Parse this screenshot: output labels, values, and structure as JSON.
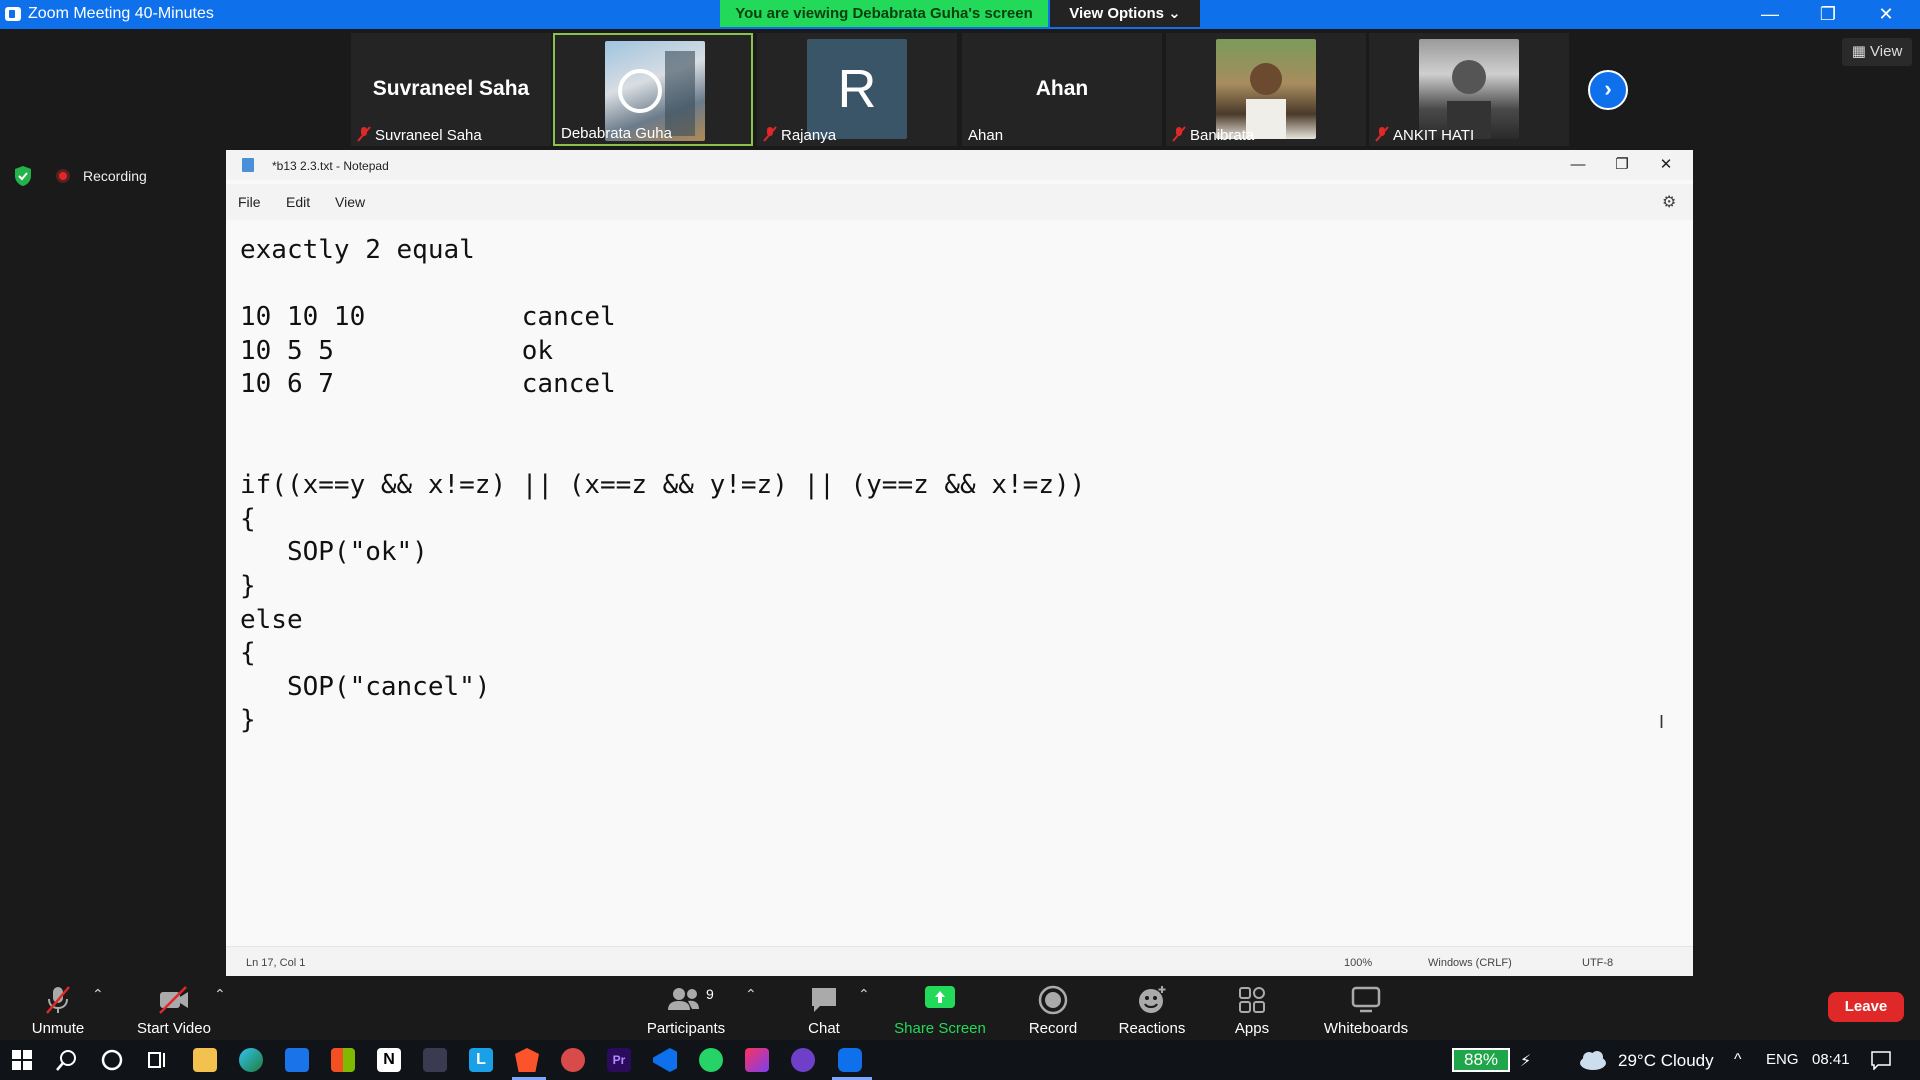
{
  "window": {
    "title": "Zoom Meeting 40-Minutes"
  },
  "banner": {
    "viewing_text": "You are viewing Debabrata Guha's screen",
    "view_options": "View Options ⌄"
  },
  "gallery": {
    "tiles": [
      {
        "big_name": "Suvraneel Saha",
        "name": "Suvraneel Saha",
        "muted": true
      },
      {
        "big_name": "",
        "name": "Debabrata Guha",
        "muted": false
      },
      {
        "big_name": "R",
        "name": "Rajanya",
        "muted": true
      },
      {
        "big_name": "Ahan",
        "name": "Ahan",
        "muted": false
      },
      {
        "big_name": "",
        "name": "Banibrata",
        "muted": true
      },
      {
        "big_name": "",
        "name": "ANKIT HATI",
        "muted": true
      }
    ],
    "view_label": "View"
  },
  "recording": {
    "label": "Recording"
  },
  "notepad": {
    "title": "*b13 2.3.txt - Notepad",
    "menu": {
      "file": "File",
      "edit": "Edit",
      "view": "View"
    },
    "content": "exactly 2 equal\n\n10 10 10          cancel\n10 5 5            ok\n10 6 7            cancel\n\n\nif((x==y && x!=z) || (x==z && y!=z) || (y==z && x!=z))\n{\n   SOP(\"ok\")\n}\nelse\n{\n   SOP(\"cancel\")\n}",
    "status": {
      "position": "Ln 17, Col 1",
      "zoom": "100%",
      "line_ending": "Windows (CRLF)",
      "encoding": "UTF-8"
    }
  },
  "toolbar": {
    "unmute": "Unmute",
    "start_video": "Start Video",
    "participants": "Participants",
    "participants_count": "9",
    "chat": "Chat",
    "share_screen": "Share Screen",
    "record": "Record",
    "reactions": "Reactions",
    "apps": "Apps",
    "whiteboards": "Whiteboards",
    "leave": "Leave"
  },
  "taskbar": {
    "battery": "88%",
    "weather": "29°C  Cloudy",
    "language": "ENG",
    "time": "08:41"
  },
  "colors": {
    "zoom_blue": "#0e71eb",
    "banner_green": "#23d959",
    "leave_red": "#e02828"
  }
}
